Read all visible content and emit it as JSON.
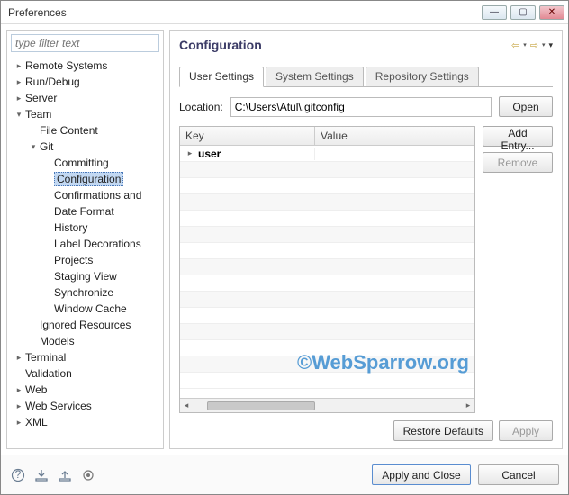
{
  "window": {
    "title": "Preferences"
  },
  "filter": {
    "placeholder": "type filter text"
  },
  "tree": {
    "items": [
      {
        "label": "Remote Systems",
        "depth": 0,
        "twist": "▷",
        "selected": false
      },
      {
        "label": "Run/Debug",
        "depth": 0,
        "twist": "▷",
        "selected": false
      },
      {
        "label": "Server",
        "depth": 0,
        "twist": "▷",
        "selected": false
      },
      {
        "label": "Team",
        "depth": 0,
        "twist": "▢",
        "selected": false
      },
      {
        "label": "File Content",
        "depth": 1,
        "twist": "",
        "selected": false
      },
      {
        "label": "Git",
        "depth": 1,
        "twist": "▢",
        "selected": false
      },
      {
        "label": "Committing",
        "depth": 2,
        "twist": "",
        "selected": false
      },
      {
        "label": "Configuration",
        "depth": 2,
        "twist": "",
        "selected": true
      },
      {
        "label": "Confirmations and",
        "depth": 2,
        "twist": "",
        "selected": false
      },
      {
        "label": "Date Format",
        "depth": 2,
        "twist": "",
        "selected": false
      },
      {
        "label": "History",
        "depth": 2,
        "twist": "",
        "selected": false
      },
      {
        "label": "Label Decorations",
        "depth": 2,
        "twist": "",
        "selected": false
      },
      {
        "label": "Projects",
        "depth": 2,
        "twist": "",
        "selected": false
      },
      {
        "label": "Staging View",
        "depth": 2,
        "twist": "",
        "selected": false
      },
      {
        "label": "Synchronize",
        "depth": 2,
        "twist": "",
        "selected": false
      },
      {
        "label": "Window Cache",
        "depth": 2,
        "twist": "",
        "selected": false
      },
      {
        "label": "Ignored Resources",
        "depth": 1,
        "twist": "",
        "selected": false
      },
      {
        "label": "Models",
        "depth": 1,
        "twist": "",
        "selected": false
      },
      {
        "label": "Terminal",
        "depth": 0,
        "twist": "▷",
        "selected": false
      },
      {
        "label": "Validation",
        "depth": 0,
        "twist": "",
        "selected": false
      },
      {
        "label": "Web",
        "depth": 0,
        "twist": "▷",
        "selected": false
      },
      {
        "label": "Web Services",
        "depth": 0,
        "twist": "▷",
        "selected": false
      },
      {
        "label": "XML",
        "depth": 0,
        "twist": "▷",
        "selected": false
      }
    ]
  },
  "main": {
    "title": "Configuration",
    "tabs": [
      {
        "label": "User Settings",
        "active": true
      },
      {
        "label": "System Settings",
        "active": false
      },
      {
        "label": "Repository Settings",
        "active": false
      }
    ],
    "location_label": "Location:",
    "location_value": "C:\\Users\\Atul\\.gitconfig",
    "open_label": "Open",
    "grid": {
      "col_key": "Key",
      "col_value": "Value",
      "rows": [
        {
          "key": "user",
          "value": "",
          "twist": "▷"
        }
      ]
    },
    "add_entry_label": "Add Entry...",
    "remove_label": "Remove",
    "restore_label": "Restore Defaults",
    "apply_label": "Apply",
    "watermark": "©WebSparrow.org"
  },
  "footer": {
    "apply_close_label": "Apply and Close",
    "cancel_label": "Cancel"
  }
}
